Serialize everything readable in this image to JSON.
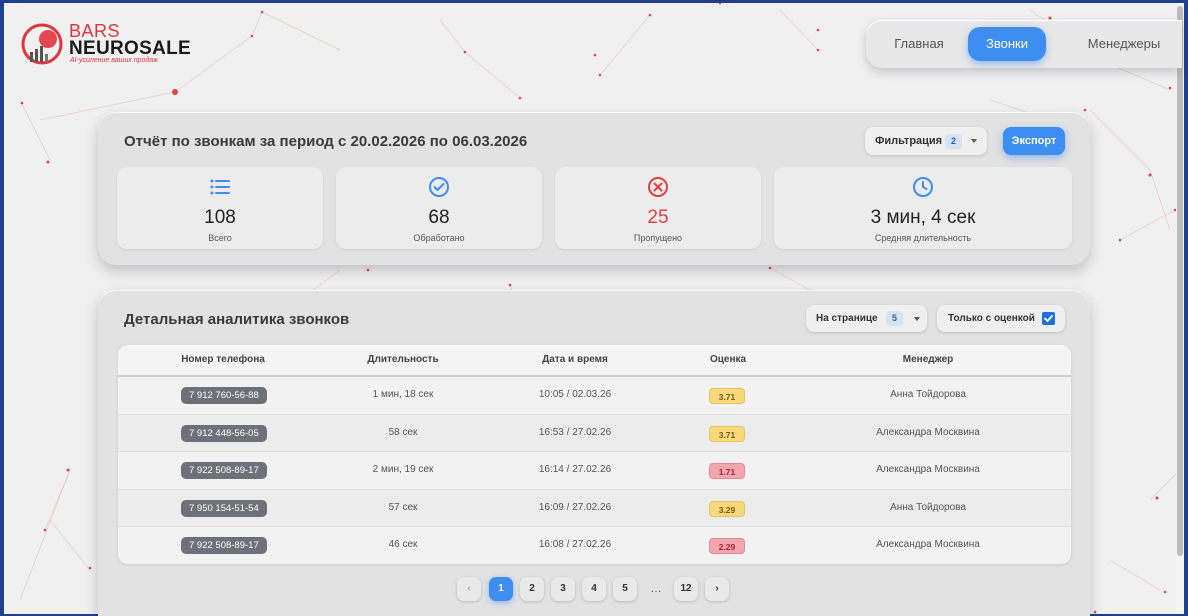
{
  "logo": {
    "brand_top": "BARS",
    "brand_main": "NEUROSALE",
    "tagline": "AI-усиление ваших продаж"
  },
  "nav": {
    "items": [
      {
        "label": "Главная",
        "active": false
      },
      {
        "label": "Звонки",
        "active": true
      },
      {
        "label": "Менеджеры",
        "active": false
      }
    ]
  },
  "report": {
    "title": "Отчёт по звонкам за период с 20.02.2026 по 06.03.2026",
    "filter_label": "Фильтрация",
    "filter_count": "2",
    "export_label": "Экспорт",
    "stats": [
      {
        "icon": "list-icon",
        "value": "108",
        "label": "Всего"
      },
      {
        "icon": "check-circle-icon",
        "value": "68",
        "label": "Обработано"
      },
      {
        "icon": "x-circle-icon",
        "value": "25",
        "label": "Пропущено"
      },
      {
        "icon": "clock-icon",
        "value": "3 мин, 4 сек",
        "label": "Средняя длительность"
      }
    ]
  },
  "details": {
    "title": "Детальная аналитика звонков",
    "per_page_label": "На странице",
    "per_page_value": "5",
    "only_rated_label": "Только с оценкой",
    "only_rated_checked": true,
    "columns": [
      "Номер телефона",
      "Длительность",
      "Дата и время",
      "Оценка",
      "Менеджер"
    ],
    "rows": [
      {
        "phone": "7 912 760-56-88",
        "duration": "1 мин, 18 сек",
        "datetime": "10:05 / 02.03.26",
        "score": "3.71",
        "score_level": "yellow",
        "manager": "Анна Тойдорова"
      },
      {
        "phone": "7 912 448-56-05",
        "duration": "58 сек",
        "datetime": "16:53 / 27.02.26",
        "score": "3.71",
        "score_level": "yellow",
        "manager": "Александра Москвина"
      },
      {
        "phone": "7 922 508-89-17",
        "duration": "2 мин, 19 сек",
        "datetime": "16:14 / 27.02.26",
        "score": "1.71",
        "score_level": "red",
        "manager": "Александра Москвина"
      },
      {
        "phone": "7 950 154-51-54",
        "duration": "57 сек",
        "datetime": "16:09 / 27.02.26",
        "score": "3.29",
        "score_level": "yellow",
        "manager": "Анна Тойдорова"
      },
      {
        "phone": "7 922 508-89-17",
        "duration": "46 сек",
        "datetime": "16:08 / 27.02.26",
        "score": "2.29",
        "score_level": "red",
        "manager": "Александра Москвина"
      }
    ],
    "pagination": {
      "prev": "‹",
      "pages": [
        "1",
        "2",
        "3",
        "4",
        "5"
      ],
      "ellipsis": "…",
      "last": "12",
      "next": "›",
      "current": "1"
    }
  },
  "colors": {
    "accent": "#3d8ef0",
    "brand_red": "#e2343e",
    "missed_red": "#e0403e",
    "score_yellow": "#f7d97c",
    "score_red": "#f2a6ad"
  }
}
